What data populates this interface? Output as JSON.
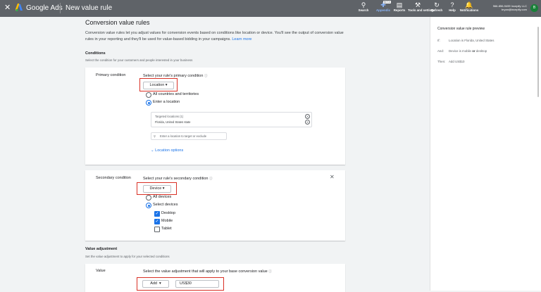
{
  "topbar": {
    "brand": "Google Ads",
    "page_title": "New value rule",
    "tools": [
      {
        "icon": "search-icon",
        "label": "Search"
      },
      {
        "icon": "appendix-icon",
        "label": "Appendix"
      },
      {
        "icon": "reports-icon",
        "label": "Reports"
      },
      {
        "icon": "wrench-icon",
        "label": "Tools and settings"
      },
      {
        "icon": "refresh-icon",
        "label": "Refresh"
      },
      {
        "icon": "help-icon",
        "label": "Help"
      },
      {
        "icon": "bell-icon",
        "label": "Notifications"
      }
    ],
    "beta_badge": "BETA",
    "account_id": "966-856-9499 Incepify LLC",
    "account_email": "bryan@incepify.com",
    "avatar_initial": "B"
  },
  "main": {
    "title": "Conversion value rules",
    "intro": "Conversion value rules let you adjust values for conversion events based on conditions like location or device. You'll see the output of conversion value rules in your reporting and they'll be used for value-based bidding in your campaigns.",
    "learn_more": "Learn more",
    "conditions": {
      "heading": "Conditions",
      "subtext": "Select the condition for your customers and people interested in your business"
    },
    "primary": {
      "label": "Primary condition",
      "question": "Select your rule's primary condition",
      "dropdown": "Location",
      "options": [
        "All countries and territories",
        "Enter a location"
      ],
      "targeted_header": "Targeted locations (1)",
      "targeted_item": "Florida, United States state",
      "search_placeholder": "Enter a location to target or exclude",
      "location_options": "Location options"
    },
    "secondary": {
      "label": "Secondary condition",
      "question": "Select your rule's secondary condition",
      "dropdown": "Device",
      "options": [
        "All devices",
        "Select devices"
      ],
      "devices": [
        {
          "label": "Desktop",
          "checked": true
        },
        {
          "label": "Mobile",
          "checked": true
        },
        {
          "label": "Tablet",
          "checked": false
        }
      ]
    },
    "value_adjustment": {
      "heading": "Value adjustment",
      "subtext": "Set the value adjustment to apply for your selected conditions",
      "label": "Value",
      "question": "Select the value adjustment that will apply to your base conversion value",
      "operation": "Add",
      "amount": "US$30"
    }
  },
  "preview": {
    "title": "Conversion value rule preview",
    "if_key": "If:",
    "if_value": "Location is Florida, United States",
    "and_key": "And:",
    "and_pre": "Device is mobile",
    "and_or": "or",
    "and_post": "desktop",
    "then_key": "Then:",
    "then_value": "Add US$10"
  },
  "colors": {
    "topbar": "#5f6368",
    "accent": "#1a73e8",
    "highlight": "#d93025"
  }
}
